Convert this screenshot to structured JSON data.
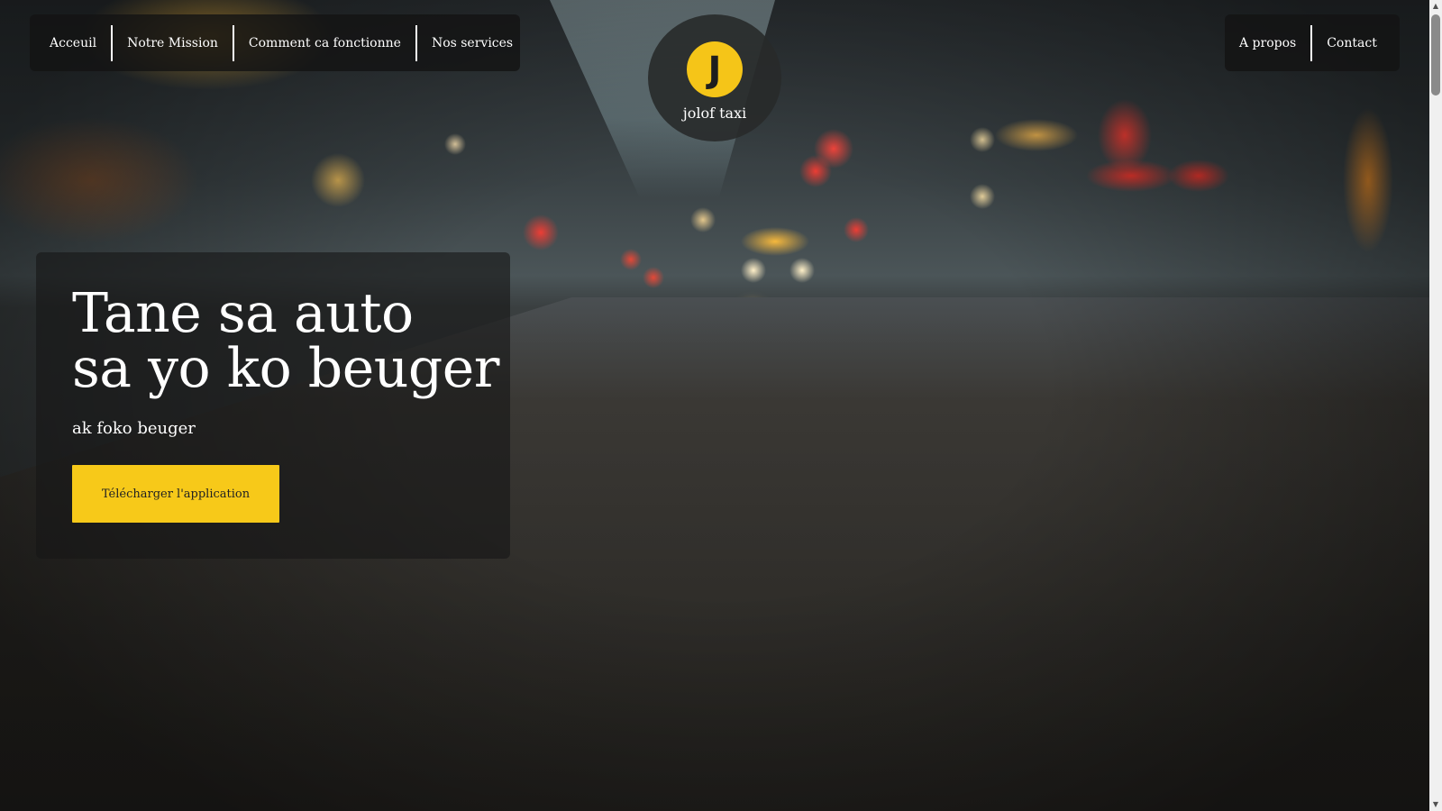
{
  "nav_left": {
    "items": [
      {
        "label": "Acceuil"
      },
      {
        "label": "Notre Mission"
      },
      {
        "label": "Comment ca fonctionne"
      },
      {
        "label": "Nos services"
      }
    ]
  },
  "nav_right": {
    "items": [
      {
        "label": "A propos"
      },
      {
        "label": "Contact"
      }
    ]
  },
  "logo": {
    "letter": "J",
    "name": "jolof taxi",
    "badge_color": "#f5c518"
  },
  "hero": {
    "title": "Tane sa auto\nsa yo ko beuger",
    "subtitle": "ak foko beuger",
    "cta_label": "Télécharger l'application",
    "cta_color": "#f7c919"
  },
  "scrollbar": {
    "up_icon": "▲",
    "down_icon": "▼"
  }
}
